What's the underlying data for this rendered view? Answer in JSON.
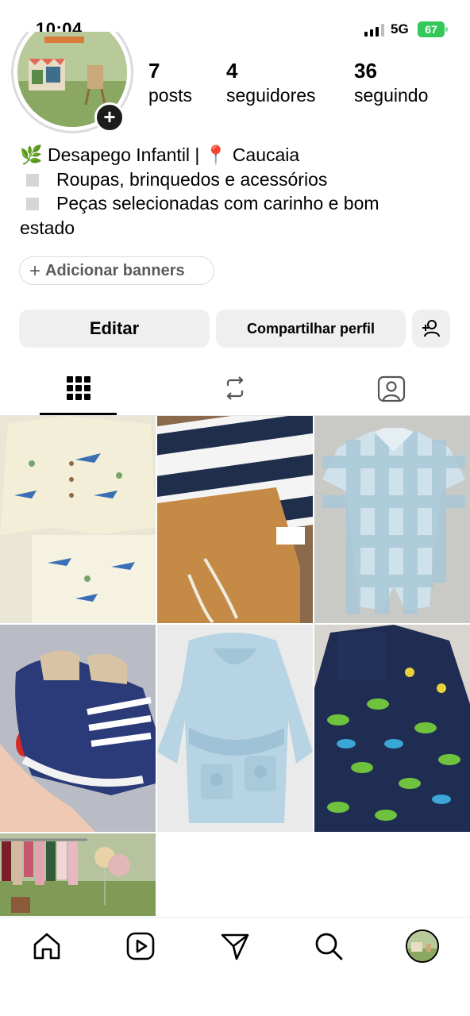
{
  "status_bar": {
    "time": "10:04",
    "network": "5G",
    "battery": "67",
    "battery_color": "#34c759"
  },
  "profile": {
    "stats": [
      {
        "value": "7",
        "label": "posts"
      },
      {
        "value": "4",
        "label": "seguidores"
      },
      {
        "value": "36",
        "label": "seguindo"
      }
    ],
    "bio": {
      "line1": "🌿 Desapego Infantil | 📍 Caucaia",
      "line2": "Roupas, brinquedos e acessórios",
      "line3": "Peças selecionadas com carinho e bom",
      "line4": "estado"
    },
    "add_story_icon": "plus-icon"
  },
  "actions": {
    "add_banners": "Adicionar banners",
    "edit": "Editar",
    "share": "Compartilhar perfil",
    "add_person_icon": "add-person-icon"
  },
  "tabs": [
    {
      "icon": "grid-icon",
      "active": true
    },
    {
      "icon": "repost-icon",
      "active": false
    },
    {
      "icon": "tagged-icon",
      "active": false
    }
  ],
  "posts": [
    {
      "subject": "shark print baby outfit"
    },
    {
      "subject": "striped shirt and brown pants"
    },
    {
      "subject": "blue gingham bodysuit"
    },
    {
      "subject": "baby sneakers in hand"
    },
    {
      "subject": "light blue bathrobe"
    },
    {
      "subject": "dinosaur print romper"
    },
    {
      "subject": "clothing rack with balloons"
    }
  ],
  "bottom_nav": [
    {
      "icon": "home-icon"
    },
    {
      "icon": "reels-icon"
    },
    {
      "icon": "send-icon"
    },
    {
      "icon": "search-icon"
    },
    {
      "icon": "profile-avatar"
    }
  ]
}
